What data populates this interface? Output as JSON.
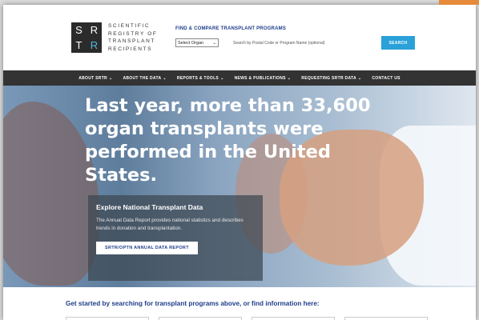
{
  "logo": {
    "letters": [
      "S",
      "R",
      "T",
      "R"
    ],
    "lines": [
      "SCIENTIFIC",
      "REGISTRY of",
      "TRANSPLANT",
      "RECIPIENTS"
    ]
  },
  "search": {
    "title": "FIND & COMPARE TRANSPLANT PROGRAMS",
    "organ_select": "Select Organ",
    "program_placeholder": "Search by Postal Code or Program Name (optional)",
    "button": "SEARCH"
  },
  "nav": {
    "items": [
      "ABOUT SRTR",
      "ABOUT THE DATA",
      "REPORTS & TOOLS",
      "NEWS & PUBLICATIONS",
      "REQUESTING SRTR DATA",
      "CONTACT US"
    ]
  },
  "hero": {
    "headline": "Last year, more than 33,600 organ transplants were performed in the United States.",
    "card_title": "Explore National Transplant Data",
    "card_desc": "The Annual Data Report provides national statistics and describes trends in donation and transplantation.",
    "card_button": "SRTR/OPTN ANNUAL DATA REPORT"
  },
  "bottom": {
    "prompt": "Get started by searching for transplant programs above, or find information here:"
  },
  "colors": {
    "nav_bg": "#333333",
    "accent_blue": "#2aa1d8",
    "heading_blue": "#1f3d8a"
  }
}
